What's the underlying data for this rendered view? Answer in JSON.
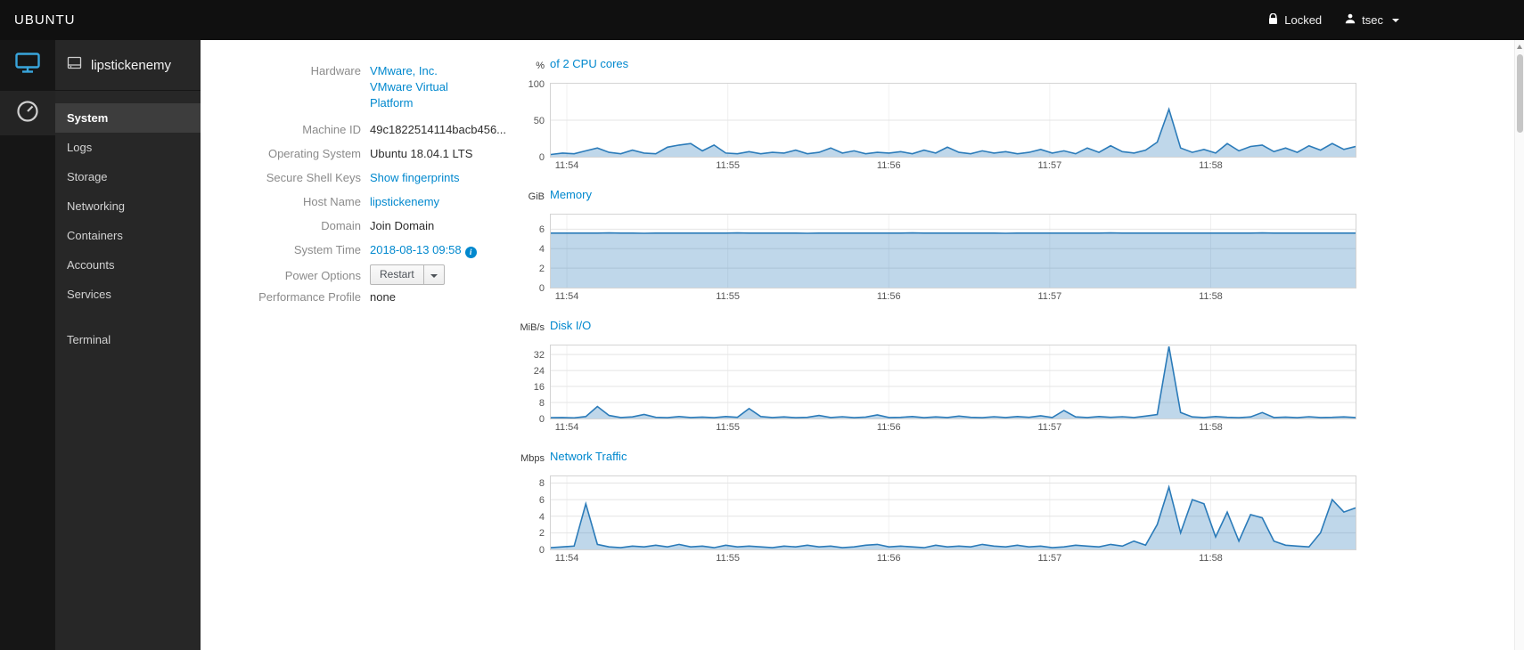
{
  "topbar": {
    "brand": "UBUNTU",
    "locked": "Locked",
    "user": "tsec"
  },
  "sidebar": {
    "hostname": "lipstickenemy",
    "items": [
      {
        "label": "System",
        "slug": "system",
        "active": true
      },
      {
        "label": "Logs",
        "slug": "logs"
      },
      {
        "label": "Storage",
        "slug": "storage"
      },
      {
        "label": "Networking",
        "slug": "networking"
      },
      {
        "label": "Containers",
        "slug": "containers"
      },
      {
        "label": "Accounts",
        "slug": "accounts"
      },
      {
        "label": "Services",
        "slug": "services"
      },
      {
        "label": "Terminal",
        "slug": "terminal",
        "group_start": true
      }
    ]
  },
  "system": {
    "hardware_label": "Hardware",
    "hardware_value": "VMware, Inc. VMware Virtual Platform",
    "machine_id_label": "Machine ID",
    "machine_id_value": "49c1822514114bacb456...",
    "os_label": "Operating System",
    "os_value": "Ubuntu 18.04.1 LTS",
    "ssh_label": "Secure Shell Keys",
    "ssh_value": "Show fingerprints",
    "hostname_label": "Host Name",
    "hostname_value": "lipstickenemy",
    "domain_label": "Domain",
    "domain_value": "Join Domain",
    "time_label": "System Time",
    "time_value": "2018-08-13 09:58",
    "power_label": "Power Options",
    "power_value": "Restart",
    "profile_label": "Performance Profile",
    "profile_value": "none"
  },
  "colors": {
    "accent": "#0088ce",
    "chart_line": "#2b7bb9",
    "chart_fill": "rgba(43,123,185,0.30)",
    "sidebar_bg": "#272727",
    "topbar_bg": "#101010"
  },
  "chart_data": [
    {
      "type": "area",
      "unit_label": "%",
      "title": "of 2 CPU cores",
      "ymax": 100,
      "yticks": [
        0,
        50,
        100
      ],
      "x_tick_labels": [
        "11:54",
        "11:55",
        "11:56",
        "11:57",
        "11:58"
      ],
      "x_tick_fracs": [
        0.02,
        0.22,
        0.42,
        0.62,
        0.82
      ],
      "values": [
        3,
        5,
        4,
        8,
        12,
        6,
        4,
        9,
        5,
        4,
        13,
        16,
        18,
        8,
        16,
        5,
        4,
        7,
        4,
        6,
        5,
        9,
        4,
        6,
        12,
        5,
        8,
        4,
        6,
        5,
        7,
        4,
        9,
        5,
        13,
        6,
        4,
        8,
        5,
        7,
        4,
        6,
        10,
        5,
        8,
        4,
        12,
        6,
        15,
        7,
        5,
        9,
        20,
        65,
        12,
        6,
        10,
        5,
        18,
        8,
        14,
        16,
        7,
        12,
        6,
        15,
        9,
        18,
        10,
        14
      ]
    },
    {
      "type": "area",
      "unit_label": "GiB",
      "title": "Memory",
      "ymax": 7.5,
      "yticks": [
        0,
        2,
        4,
        6
      ],
      "x_tick_labels": [
        "11:54",
        "11:55",
        "11:56",
        "11:57",
        "11:58"
      ],
      "x_tick_fracs": [
        0.02,
        0.22,
        0.42,
        0.62,
        0.82
      ],
      "values": [
        5.6,
        5.6,
        5.6,
        5.6,
        5.6,
        5.62,
        5.6,
        5.6,
        5.58,
        5.6,
        5.6,
        5.6,
        5.6,
        5.6,
        5.6,
        5.6,
        5.62,
        5.6,
        5.6,
        5.6,
        5.6,
        5.6,
        5.58,
        5.6,
        5.6,
        5.6,
        5.6,
        5.6,
        5.6,
        5.6,
        5.6,
        5.62,
        5.6,
        5.6,
        5.6,
        5.6,
        5.6,
        5.6,
        5.6,
        5.58,
        5.6,
        5.6,
        5.6,
        5.6,
        5.6,
        5.6,
        5.6,
        5.6,
        5.62,
        5.6,
        5.6,
        5.6,
        5.6,
        5.6,
        5.6,
        5.6,
        5.6,
        5.6,
        5.6,
        5.6,
        5.6,
        5.62,
        5.6,
        5.6,
        5.6,
        5.6,
        5.6,
        5.6,
        5.6,
        5.6
      ]
    },
    {
      "type": "area",
      "unit_label": "MiB/s",
      "title": "Disk I/O",
      "ymax": 36.5,
      "yticks": [
        0,
        8,
        16,
        24,
        32
      ],
      "x_tick_labels": [
        "11:54",
        "11:55",
        "11:56",
        "11:57",
        "11:58"
      ],
      "x_tick_fracs": [
        0.02,
        0.22,
        0.42,
        0.62,
        0.82
      ],
      "values": [
        0.4,
        0.5,
        0.3,
        1,
        6,
        1.5,
        0.5,
        0.8,
        2,
        0.6,
        0.4,
        1,
        0.5,
        0.7,
        0.4,
        1,
        0.6,
        5,
        1,
        0.5,
        0.8,
        0.4,
        0.6,
        1.5,
        0.5,
        0.9,
        0.4,
        0.7,
        1.8,
        0.5,
        0.6,
        1,
        0.4,
        0.8,
        0.5,
        1.2,
        0.6,
        0.4,
        0.9,
        0.5,
        1,
        0.6,
        1.4,
        0.5,
        4,
        0.8,
        0.5,
        1,
        0.6,
        0.9,
        0.5,
        1.2,
        2,
        36,
        3,
        0.8,
        0.5,
        1,
        0.6,
        0.4,
        0.8,
        3,
        0.5,
        0.7,
        0.4,
        0.9,
        0.5,
        0.6,
        0.8,
        0.5
      ]
    },
    {
      "type": "area",
      "unit_label": "Mbps",
      "title": "Network Traffic",
      "ymax": 8.8,
      "yticks": [
        0,
        2,
        4,
        6,
        8
      ],
      "x_tick_labels": [
        "11:54",
        "11:55",
        "11:56",
        "11:57",
        "11:58"
      ],
      "x_tick_fracs": [
        0.02,
        0.22,
        0.42,
        0.62,
        0.82
      ],
      "values": [
        0.2,
        0.3,
        0.4,
        5.5,
        0.6,
        0.3,
        0.2,
        0.4,
        0.3,
        0.5,
        0.3,
        0.6,
        0.3,
        0.4,
        0.2,
        0.5,
        0.3,
        0.4,
        0.3,
        0.2,
        0.4,
        0.3,
        0.5,
        0.3,
        0.4,
        0.2,
        0.3,
        0.5,
        0.6,
        0.3,
        0.4,
        0.3,
        0.2,
        0.5,
        0.3,
        0.4,
        0.3,
        0.6,
        0.4,
        0.3,
        0.5,
        0.3,
        0.4,
        0.2,
        0.3,
        0.5,
        0.4,
        0.3,
        0.6,
        0.4,
        1,
        0.5,
        3,
        7.5,
        2,
        6,
        5.5,
        1.5,
        4.5,
        1,
        4.2,
        3.8,
        1,
        0.5,
        0.4,
        0.3,
        2,
        6,
        4.5,
        5
      ]
    }
  ]
}
